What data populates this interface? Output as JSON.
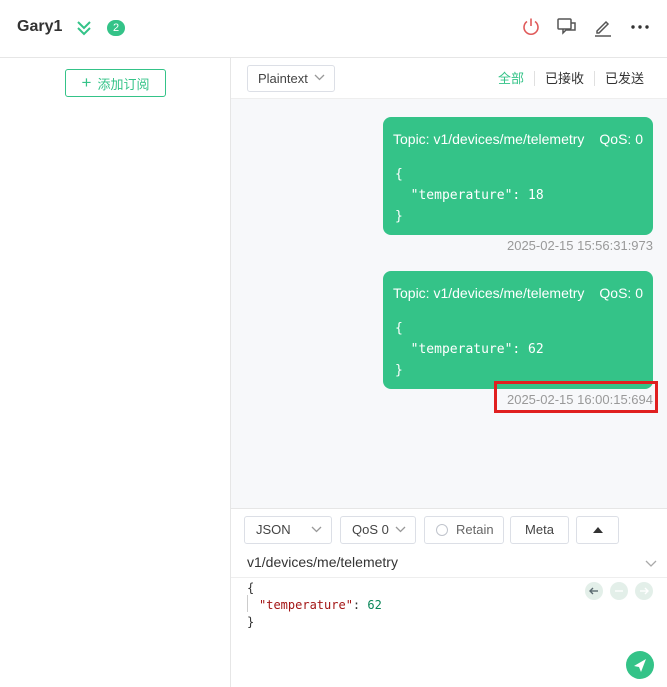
{
  "header": {
    "connection_name": "Gary1",
    "badge_count": "2",
    "colors": {
      "accent": "#34c388",
      "power": "#e05a5a"
    }
  },
  "sidebar": {
    "add_subscription_label": "添加订阅"
  },
  "toolbar": {
    "format": "Plaintext",
    "filters": [
      "全部",
      "已接收",
      "已发送"
    ]
  },
  "messages": [
    {
      "topic": "Topic: v1/devices/me/telemetry",
      "qos": "QoS: 0",
      "payload_lines": [
        "{",
        "  \"temperature\": 18",
        "}"
      ],
      "time": "2025-02-15 15:56:31:973"
    },
    {
      "topic": "Topic: v1/devices/me/telemetry",
      "qos": "QoS: 0",
      "payload_lines": [
        "{",
        "  \"temperature\": 62",
        "}"
      ],
      "time": "2025-02-15 16:00:15:694"
    }
  ],
  "publish": {
    "payload_format": "JSON",
    "qos": "QoS 0",
    "retain_label": "Retain",
    "meta_label": "Meta",
    "topic": "v1/devices/me/telemetry",
    "editor": {
      "open": "{",
      "key": "\"temperature\"",
      "sep": ": ",
      "value": "62",
      "close": "}"
    }
  }
}
